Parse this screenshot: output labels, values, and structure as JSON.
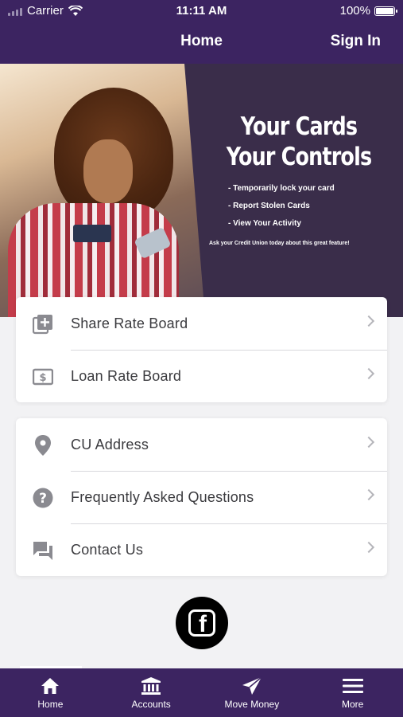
{
  "status_bar": {
    "carrier": "Carrier",
    "time": "11:11 AM",
    "battery": "100%"
  },
  "nav": {
    "title": "Home",
    "sign_in": "Sign In"
  },
  "banner": {
    "headline_line1": "Your Cards",
    "headline_line2": "Your Controls",
    "bullets": [
      "- Temporarily lock your card",
      "- Report Stolen Cards",
      "- View Your Activity"
    ],
    "note": "Ask your Credit Union today about this great feature!"
  },
  "menu_group_1": [
    {
      "label": "Share Rate Board",
      "icon": "add-box-icon"
    },
    {
      "label": "Loan Rate Board",
      "icon": "dollar-bill-icon"
    }
  ],
  "menu_group_2": [
    {
      "label": "CU Address",
      "icon": "location-pin-icon"
    },
    {
      "label": "Frequently Asked Questions",
      "icon": "help-circle-icon"
    },
    {
      "label": "Contact Us",
      "icon": "chat-icon"
    }
  ],
  "social": {
    "icon": "facebook-icon"
  },
  "tabbar": [
    {
      "label": "Home",
      "icon": "home-icon"
    },
    {
      "label": "Accounts",
      "icon": "bank-icon"
    },
    {
      "label": "Move Money",
      "icon": "send-icon"
    },
    {
      "label": "More",
      "icon": "menu-icon"
    }
  ],
  "colors": {
    "brand_purple": "#3c2461",
    "icon_gray": "#8a8a90",
    "chevron_gray": "#b5b5ba"
  }
}
